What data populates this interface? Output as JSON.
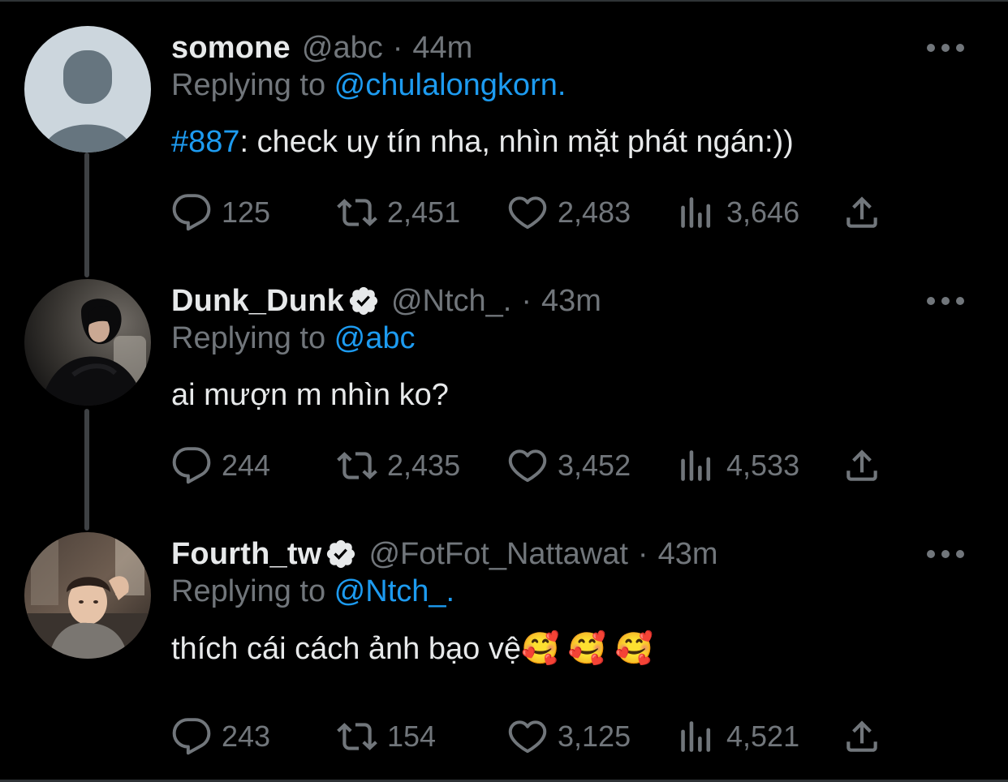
{
  "tweets": [
    {
      "name": "somone",
      "handle": "@abc",
      "dot": "·",
      "time": "44m",
      "verified": false,
      "replying_prefix": "Replying to ",
      "replying_to": "@chulalongkorn.",
      "hashtag": "#887",
      "text": ": check uy tín nha, nhìn mặt phát ngán:))",
      "stats": {
        "replies": "125",
        "retweets": "2,451",
        "likes": "2,483",
        "views": "3,646"
      }
    },
    {
      "name": "Dunk_Dunk",
      "handle": "@Ntch_.",
      "dot": "·",
      "time": "43m",
      "verified": true,
      "replying_prefix": "Replying to ",
      "replying_to": "@abc",
      "text": "ai mượn m nhìn ko?",
      "stats": {
        "replies": "244",
        "retweets": "2,435",
        "likes": "3,452",
        "views": "4,533"
      }
    },
    {
      "name": "Fourth_tw",
      "handle": "@FotFot_Nattawat",
      "dot": "·",
      "time": "43m",
      "verified": true,
      "replying_prefix": "Replying to ",
      "replying_to": "@Ntch_.",
      "text": "thích cái cách ảnh bạo vệ🥰 🥰 🥰",
      "stats": {
        "replies": "243",
        "retweets": "154",
        "likes": "3,125",
        "views": "4,521"
      }
    }
  ],
  "icons": {
    "reply": "speech-bubble-icon",
    "retweet": "retweet-icon",
    "like": "heart-icon",
    "views": "bar-chart-icon",
    "share": "share-upload-icon",
    "more": "more-dots-icon",
    "verified": "verified-badge-icon"
  },
  "colors": {
    "background": "#000000",
    "text": "#e7e9ea",
    "muted": "#71767b",
    "accent": "#1d9bf0",
    "thread_line": "#3e4144"
  }
}
